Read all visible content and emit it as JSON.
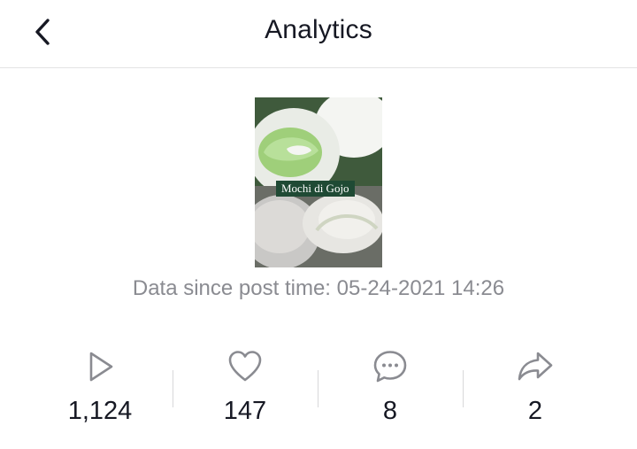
{
  "header": {
    "title": "Analytics",
    "back_icon": "chevron-left-icon"
  },
  "post": {
    "thumbnail_caption": "Mochi di Gojo",
    "data_since": "Data since post time: 05-24-2021 14:26"
  },
  "stats": [
    {
      "name": "views",
      "icon": "play-icon",
      "value": "1,124"
    },
    {
      "name": "likes",
      "icon": "heart-icon",
      "value": "147"
    },
    {
      "name": "comments",
      "icon": "comment-icon",
      "value": "8"
    },
    {
      "name": "shares",
      "icon": "share-icon",
      "value": "2"
    }
  ],
  "colors": {
    "text_primary": "#161823",
    "text_secondary": "#8a8b91",
    "icon": "#8a8b91",
    "caption_bg": "#1f4a34"
  }
}
